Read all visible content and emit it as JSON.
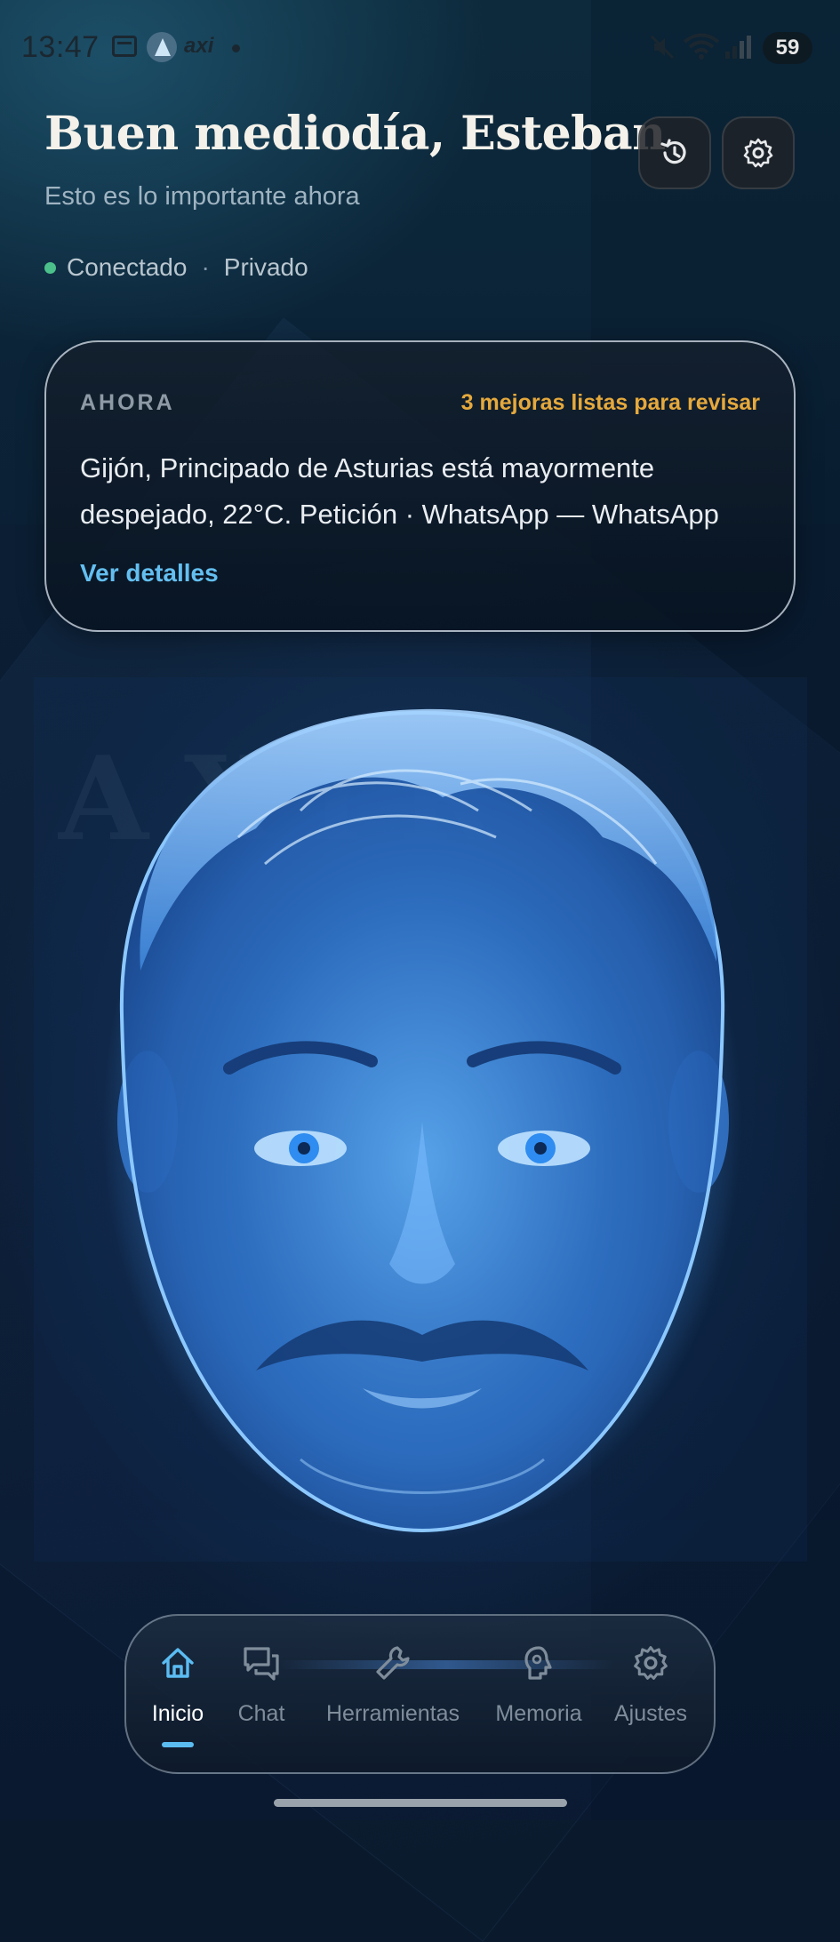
{
  "status_bar": {
    "time": "13:47",
    "app_label": "axi",
    "battery": "59"
  },
  "header": {
    "greeting": "Buen mediodía, Esteban",
    "subtitle": "Esto es lo importante ahora",
    "status_connected": "Conectado",
    "separator": "·",
    "status_private": "Privado",
    "icons": {
      "history": "history-icon",
      "settings": "gear-icon"
    }
  },
  "now_card": {
    "kicker": "AHORA",
    "badge": "3 mejoras listas para revisar",
    "body": "Gijón, Principado de Asturias está mayormente despejado, 22°C. Petición · WhatsApp — WhatsApp",
    "link": "Ver detalles"
  },
  "avatar": {
    "watermark": "AXIR"
  },
  "bottom_nav": {
    "items": [
      {
        "label": "Inicio",
        "icon": "home-icon",
        "active": true
      },
      {
        "label": "Chat",
        "icon": "chat-icon",
        "active": false
      },
      {
        "label": "Herramientas",
        "icon": "wrench-icon",
        "active": false
      },
      {
        "label": "Memoria",
        "icon": "brain-icon",
        "active": false
      },
      {
        "label": "Ajustes",
        "icon": "gear-icon",
        "active": false
      }
    ]
  },
  "colors": {
    "accent": "#5bbcf2",
    "badge": "#e6a93c",
    "online": "#4cc08a"
  }
}
